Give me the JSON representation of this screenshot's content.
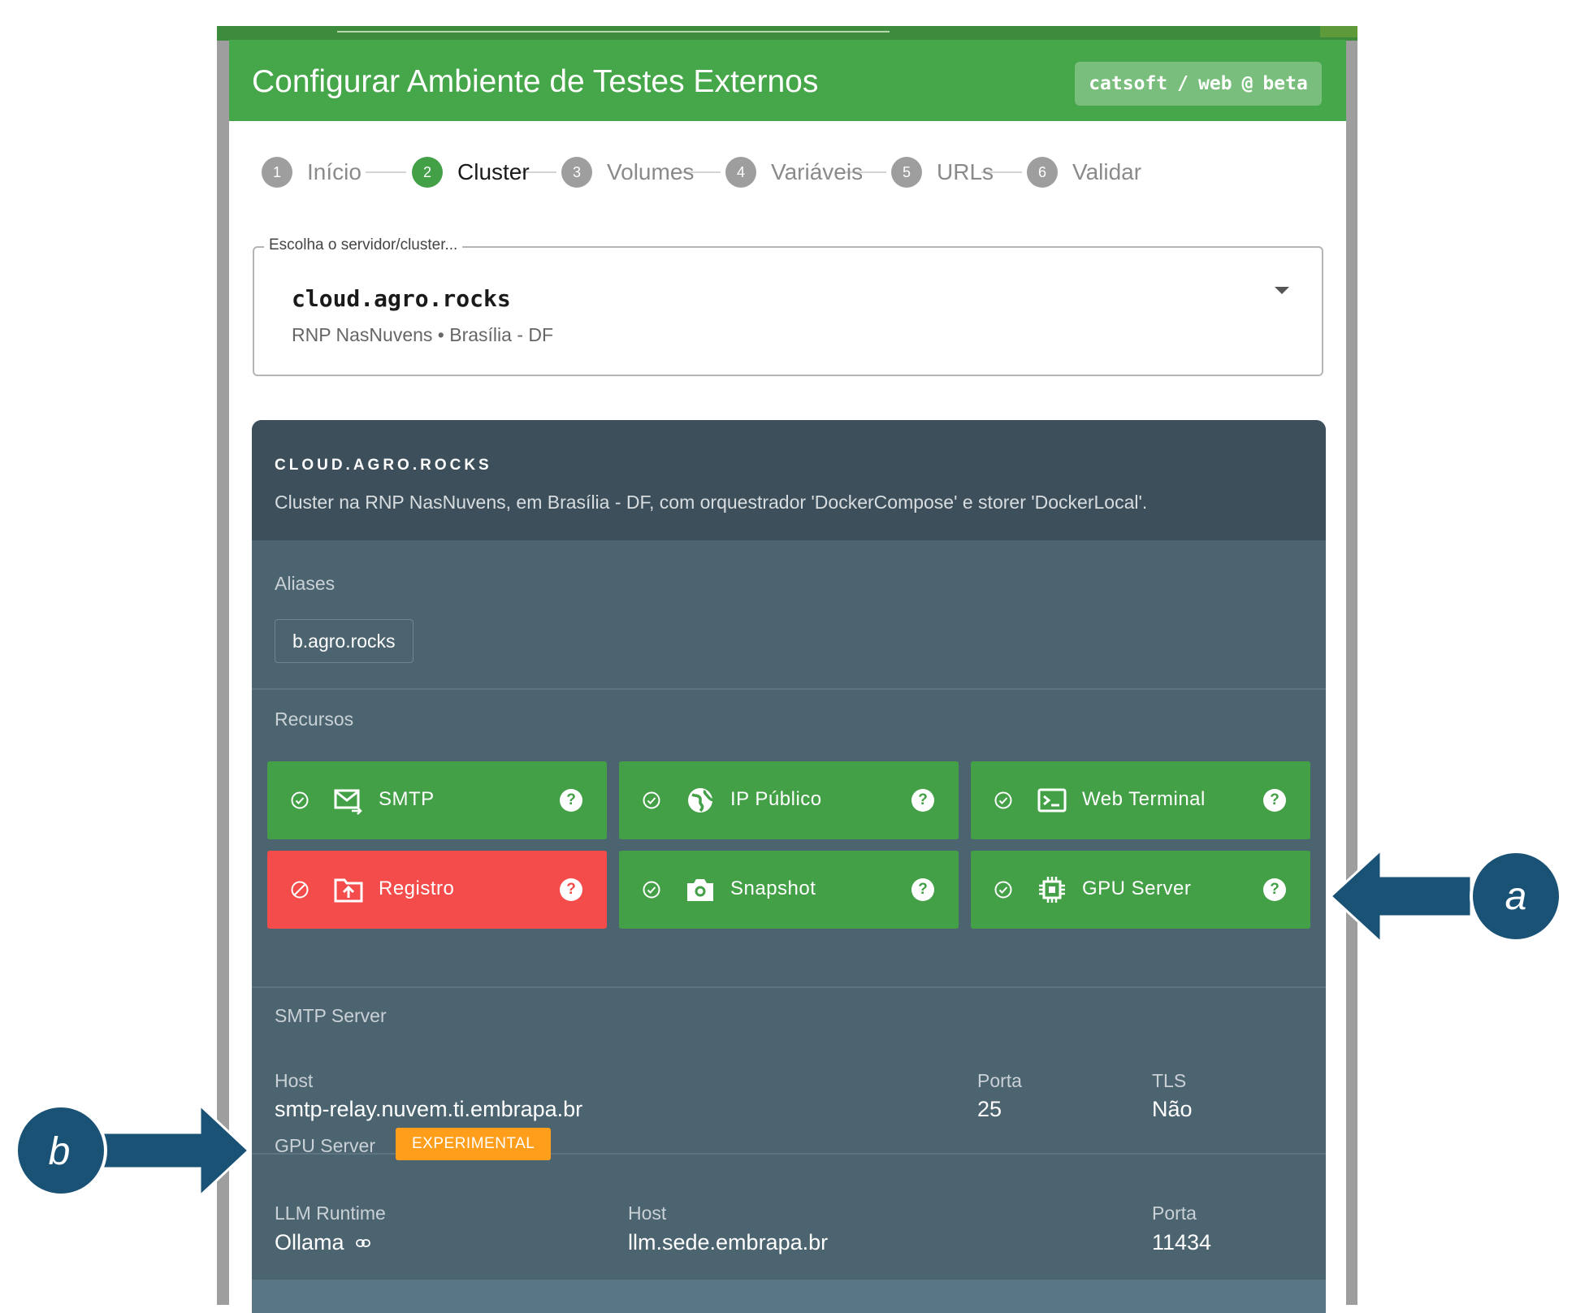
{
  "window": {
    "title": "Configurar Ambiente de Testes Externos",
    "project": {
      "org": "catsoft",
      "sep1": "/",
      "repo": "web",
      "sep2": "@",
      "branch": "beta"
    }
  },
  "stepper": {
    "steps": [
      {
        "number": "1",
        "label": "Início",
        "active": false
      },
      {
        "number": "2",
        "label": "Cluster",
        "active": true
      },
      {
        "number": "3",
        "label": "Volumes",
        "active": false
      },
      {
        "number": "4",
        "label": "Variáveis",
        "active": false
      },
      {
        "number": "5",
        "label": "URLs",
        "active": false
      },
      {
        "number": "6",
        "label": "Validar",
        "active": false
      }
    ]
  },
  "cluster_select": {
    "legend": "Escolha o servidor/cluster...",
    "value": "cloud.agro.rocks",
    "subtitle": "RNP NasNuvens • Brasília - DF"
  },
  "cluster_card": {
    "title": "CLOUD.AGRO.ROCKS",
    "description": "Cluster na RNP NasNuvens, em Brasília - DF, com orquestrador 'DockerCompose' e storer 'DockerLocal'.",
    "aliases_label": "Aliases",
    "aliases": [
      "b.agro.rocks"
    ],
    "resources_label": "Recursos",
    "resources": [
      {
        "label": "SMTP",
        "icon": "email-send-icon",
        "available": true,
        "color": "#43a047"
      },
      {
        "label": "IP Público",
        "icon": "globe-icon",
        "available": true,
        "color": "#43a047"
      },
      {
        "label": "Web Terminal",
        "icon": "terminal-icon",
        "available": true,
        "color": "#43a047"
      },
      {
        "label": "Registro",
        "icon": "folder-upload-icon",
        "available": false,
        "color": "#f44b4b"
      },
      {
        "label": "Snapshot",
        "icon": "camera-icon",
        "available": true,
        "color": "#43a047"
      },
      {
        "label": "GPU Server",
        "icon": "chip-icon",
        "available": true,
        "color": "#43a047"
      }
    ],
    "smtp": {
      "section_label": "SMTP Server",
      "host_label": "Host",
      "host": "smtp-relay.nuvem.ti.embrapa.br",
      "port_label": "Porta",
      "port": "25",
      "tls_label": "TLS",
      "tls": "Não"
    },
    "gpu": {
      "section_label": "GPU Server",
      "badge": "EXPERIMENTAL",
      "runtime_label": "LLM Runtime",
      "runtime": "Ollama",
      "host_label": "Host",
      "host": "llm.sede.embrapa.br",
      "port_label": "Porta",
      "port": "11434"
    }
  },
  "callouts": {
    "a": "a",
    "b": "b"
  },
  "colors": {
    "header_green": "#46a64a",
    "available_green": "#43a047",
    "unavailable_red": "#f44b4b",
    "badge_orange": "#ff9e1b",
    "card_body": "#4c6470",
    "card_head": "#3c4f5a",
    "callout_navy": "#1a5276"
  }
}
